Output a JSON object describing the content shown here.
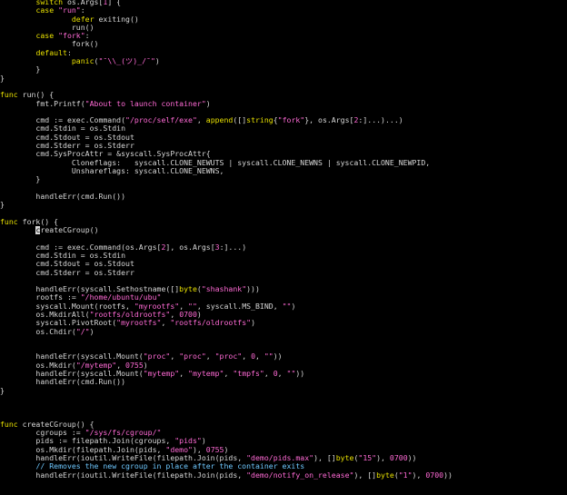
{
  "colors": {
    "background": "#000000",
    "plain": "#d8d8d8",
    "keyword": "#e8e000",
    "string": "#ff6ad5",
    "comment": "#6ec8ff"
  },
  "lines": [
    [
      [
        "p",
        "        "
      ],
      [
        "k",
        "switch"
      ],
      [
        "p",
        " os.Args["
      ],
      [
        "s",
        "1"
      ],
      [
        "p",
        "] {"
      ]
    ],
    [
      [
        "p",
        "        "
      ],
      [
        "k",
        "case"
      ],
      [
        "p",
        " "
      ],
      [
        "s",
        "\"run\""
      ],
      [
        "p",
        ":"
      ]
    ],
    [
      [
        "p",
        "                "
      ],
      [
        "k",
        "defer"
      ],
      [
        "p",
        " exiting()"
      ]
    ],
    [
      [
        "p",
        "                run()"
      ]
    ],
    [
      [
        "p",
        "        "
      ],
      [
        "k",
        "case"
      ],
      [
        "p",
        " "
      ],
      [
        "s",
        "\"fork\""
      ],
      [
        "p",
        ":"
      ]
    ],
    [
      [
        "p",
        "                fork()"
      ]
    ],
    [
      [
        "p",
        "        "
      ],
      [
        "k",
        "default"
      ],
      [
        "p",
        ":"
      ]
    ],
    [
      [
        "p",
        "                "
      ],
      [
        "k",
        "panic"
      ],
      [
        "p",
        "("
      ],
      [
        "s",
        "\"¯\\\\_(ツ)_/¯\""
      ],
      [
        "p",
        ")"
      ]
    ],
    [
      [
        "p",
        "        }"
      ]
    ],
    [
      [
        "p",
        "}"
      ]
    ],
    [],
    [
      [
        "k",
        "func"
      ],
      [
        "p",
        " run() {"
      ]
    ],
    [
      [
        "p",
        "        fmt.Printf("
      ],
      [
        "s",
        "\"About to launch container\""
      ],
      [
        "p",
        ")"
      ]
    ],
    [],
    [
      [
        "p",
        "        cmd := exec.Command("
      ],
      [
        "s",
        "\"/proc/self/exe\""
      ],
      [
        "p",
        ", "
      ],
      [
        "k",
        "append"
      ],
      [
        "p",
        "([]"
      ],
      [
        "k",
        "string"
      ],
      [
        "p",
        "{"
      ],
      [
        "s",
        "\"fork\""
      ],
      [
        "p",
        "}, os.Args["
      ],
      [
        "s",
        "2"
      ],
      [
        "p",
        ":]...)...)"
      ]
    ],
    [
      [
        "p",
        "        cmd.Stdin = os.Stdin"
      ]
    ],
    [
      [
        "p",
        "        cmd.Stdout = os.Stdout"
      ]
    ],
    [
      [
        "p",
        "        cmd.Stderr = os.Stderr"
      ]
    ],
    [
      [
        "p",
        "        cmd.SysProcAttr = &syscall.SysProcAttr{"
      ]
    ],
    [
      [
        "p",
        "                Cloneflags:   syscall.CLONE_NEWUTS | syscall.CLONE_NEWNS | syscall.CLONE_NEWPID,"
      ]
    ],
    [
      [
        "p",
        "                Unshareflags: syscall.CLONE_NEWNS,"
      ]
    ],
    [
      [
        "p",
        "        }"
      ]
    ],
    [],
    [
      [
        "p",
        "        handleErr(cmd.Run())"
      ]
    ],
    [
      [
        "p",
        "}"
      ]
    ],
    [],
    [
      [
        "k",
        "func"
      ],
      [
        "p",
        " fork() {"
      ]
    ],
    [
      [
        "p",
        "        "
      ],
      [
        "cur",
        "c"
      ],
      [
        "p",
        "reateCGroup()"
      ]
    ],
    [],
    [
      [
        "p",
        "        cmd := exec.Command(os.Args["
      ],
      [
        "s",
        "2"
      ],
      [
        "p",
        "], os.Args["
      ],
      [
        "s",
        "3"
      ],
      [
        "p",
        ":]...)"
      ]
    ],
    [
      [
        "p",
        "        cmd.Stdin = os.Stdin"
      ]
    ],
    [
      [
        "p",
        "        cmd.Stdout = os.Stdout"
      ]
    ],
    [
      [
        "p",
        "        cmd.Stderr = os.Stderr"
      ]
    ],
    [],
    [
      [
        "p",
        "        handleErr(syscall.Sethostname([]"
      ],
      [
        "k",
        "byte"
      ],
      [
        "p",
        "("
      ],
      [
        "s",
        "\"shashank\""
      ],
      [
        "p",
        ")))"
      ]
    ],
    [
      [
        "p",
        "        rootfs := "
      ],
      [
        "s",
        "\"/home/ubuntu/ubu\""
      ]
    ],
    [
      [
        "p",
        "        syscall.Mount(rootfs, "
      ],
      [
        "s",
        "\"myrootfs\""
      ],
      [
        "p",
        ", "
      ],
      [
        "s",
        "\"\""
      ],
      [
        "p",
        ", syscall.MS_BIND, "
      ],
      [
        "s",
        "\"\""
      ],
      [
        "p",
        ")"
      ]
    ],
    [
      [
        "p",
        "        os.MkdirAll("
      ],
      [
        "s",
        "\"rootfs/oldrootfs\""
      ],
      [
        "p",
        ", "
      ],
      [
        "s",
        "0700"
      ],
      [
        "p",
        ")"
      ]
    ],
    [
      [
        "p",
        "        syscall.PivotRoot("
      ],
      [
        "s",
        "\"myrootfs\""
      ],
      [
        "p",
        ", "
      ],
      [
        "s",
        "\"rootfs/oldrootfs\""
      ],
      [
        "p",
        ")"
      ]
    ],
    [
      [
        "p",
        "        os.Chdir("
      ],
      [
        "s",
        "\"/\""
      ],
      [
        "p",
        ")"
      ]
    ],
    [],
    [],
    [
      [
        "p",
        "        handleErr(syscall.Mount("
      ],
      [
        "s",
        "\"proc\""
      ],
      [
        "p",
        ", "
      ],
      [
        "s",
        "\"proc\""
      ],
      [
        "p",
        ", "
      ],
      [
        "s",
        "\"proc\""
      ],
      [
        "p",
        ", "
      ],
      [
        "s",
        "0"
      ],
      [
        "p",
        ", "
      ],
      [
        "s",
        "\"\""
      ],
      [
        "p",
        "))"
      ]
    ],
    [
      [
        "p",
        "        os.Mkdir("
      ],
      [
        "s",
        "\"/mytemp\""
      ],
      [
        "p",
        ", "
      ],
      [
        "s",
        "0755"
      ],
      [
        "p",
        ")"
      ]
    ],
    [
      [
        "p",
        "        handleErr(syscall.Mount("
      ],
      [
        "s",
        "\"mytemp\""
      ],
      [
        "p",
        ", "
      ],
      [
        "s",
        "\"mytemp\""
      ],
      [
        "p",
        ", "
      ],
      [
        "s",
        "\"tmpfs\""
      ],
      [
        "p",
        ", "
      ],
      [
        "s",
        "0"
      ],
      [
        "p",
        ", "
      ],
      [
        "s",
        "\"\""
      ],
      [
        "p",
        "))"
      ]
    ],
    [
      [
        "p",
        "        handleErr(cmd.Run())"
      ]
    ],
    [
      [
        "p",
        "}"
      ]
    ],
    [],
    [],
    [],
    [
      [
        "k",
        "func"
      ],
      [
        "p",
        " createCGroup() {"
      ]
    ],
    [
      [
        "p",
        "        cgroups := "
      ],
      [
        "s",
        "\"/sys/fs/cgroup/\""
      ]
    ],
    [
      [
        "p",
        "        pids := filepath.Join(cgroups, "
      ],
      [
        "s",
        "\"pids\""
      ],
      [
        "p",
        ")"
      ]
    ],
    [
      [
        "p",
        "        os.Mkdir(filepath.Join(pids, "
      ],
      [
        "s",
        "\"demo\""
      ],
      [
        "p",
        "), "
      ],
      [
        "s",
        "0755"
      ],
      [
        "p",
        ")"
      ]
    ],
    [
      [
        "p",
        "        handleErr(ioutil.WriteFile(filepath.Join(pids, "
      ],
      [
        "s",
        "\"demo/pids.max\""
      ],
      [
        "p",
        "), []"
      ],
      [
        "k",
        "byte"
      ],
      [
        "p",
        "("
      ],
      [
        "s",
        "\"15\""
      ],
      [
        "p",
        "), "
      ],
      [
        "s",
        "0700"
      ],
      [
        "p",
        "))"
      ]
    ],
    [
      [
        "p",
        "        "
      ],
      [
        "c",
        "// Removes the new cgroup in place after the container exits"
      ]
    ],
    [
      [
        "p",
        "        handleErr(ioutil.WriteFile(filepath.Join(pids, "
      ],
      [
        "s",
        "\"demo/notify_on_release\""
      ],
      [
        "p",
        "), []"
      ],
      [
        "k",
        "byte"
      ],
      [
        "p",
        "("
      ],
      [
        "s",
        "\"1\""
      ],
      [
        "p",
        "), "
      ],
      [
        "s",
        "0700"
      ],
      [
        "p",
        "))"
      ]
    ]
  ]
}
